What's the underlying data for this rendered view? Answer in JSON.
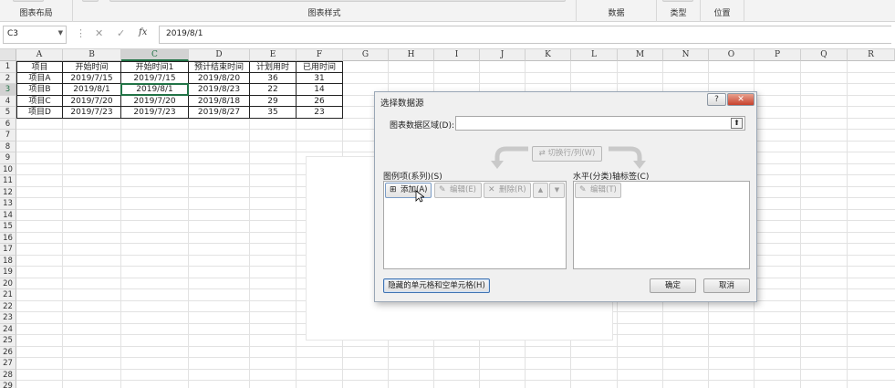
{
  "ribbon": {
    "groups": [
      {
        "label": "图表布局"
      },
      {
        "label": "图表样式"
      },
      {
        "label": "数据"
      },
      {
        "label": "类型"
      },
      {
        "label": "位置"
      }
    ]
  },
  "formula_bar": {
    "name_box": "C3",
    "fx_label": "fx",
    "value": "2019/8/1"
  },
  "sheet": {
    "columns": [
      "A",
      "B",
      "C",
      "D",
      "E",
      "F",
      "G",
      "H",
      "I",
      "J",
      "K",
      "L",
      "M",
      "N",
      "O",
      "P",
      "Q",
      "R"
    ],
    "selected_column": "C",
    "row_numbers": [
      "1",
      "2",
      "3",
      "4",
      "5",
      "6",
      "7",
      "8",
      "9",
      "10",
      "11",
      "12",
      "13",
      "14",
      "15",
      "16",
      "17",
      "18",
      "19",
      "20",
      "21",
      "22",
      "23",
      "24",
      "25",
      "26",
      "27",
      "28",
      "29"
    ],
    "selected_row": "3",
    "table": [
      [
        "项目",
        "开始时间",
        "开始时间1",
        "预计结束时间",
        "计划用时",
        "已用时间"
      ],
      [
        "项目A",
        "2019/7/15",
        "2019/7/15",
        "2019/8/20",
        "36",
        "31"
      ],
      [
        "项目B",
        "2019/8/1",
        "2019/8/1",
        "2019/8/23",
        "22",
        "14"
      ],
      [
        "项目C",
        "2019/7/20",
        "2019/7/20",
        "2019/8/18",
        "29",
        "26"
      ],
      [
        "项目D",
        "2019/7/23",
        "2019/7/23",
        "2019/8/27",
        "35",
        "23"
      ]
    ]
  },
  "dialog": {
    "title": "选择数据源",
    "help": "?",
    "close": "✕",
    "range_label": "图表数据区域(D):",
    "range_value": "",
    "switch_label": "切换行/列(W)",
    "legend_label": "图例项(系列)(S)",
    "add_label": "添加(A)",
    "edit_label": "编辑(E)",
    "delete_label": "删除(R)",
    "axis_label": "水平(分类)轴标签(C)",
    "axis_edit_label": "编辑(T)",
    "hidden_label": "隐藏的单元格和空单元格(H)",
    "ok_label": "确定",
    "cancel_label": "取消"
  }
}
